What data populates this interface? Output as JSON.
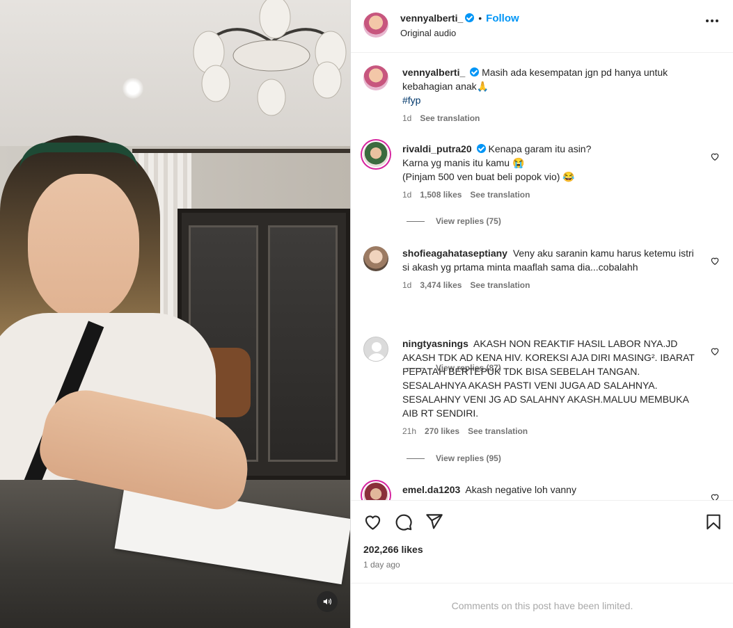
{
  "post": {
    "author": "vennyalberti_",
    "follow_label": "Follow",
    "dot": "•",
    "audio": "Original audio",
    "caption_username": "vennyalberti_",
    "caption_text": "Masih ada kesempatan jgn pd hanya untuk kebahagian anak🙏",
    "caption_hashtag": "#fyp",
    "caption_time": "1d",
    "caption_see_translation": "See translation",
    "likes": "202,266 likes",
    "time_ago": "1 day ago",
    "comments_limited": "Comments on this post have been limited."
  },
  "comments": [
    {
      "username": "rivaldi_putra20",
      "verified": true,
      "lines": [
        "Kenapa garam itu asin?",
        "Karna yg manis itu kamu 😭",
        "(Pinjam 500 ven buat beli popok vio) 😂"
      ],
      "time": "1d",
      "likes": "1,508 likes",
      "see_translation": "See translation",
      "replies": "View replies (75)"
    },
    {
      "username": "shofieagahataseptiany",
      "verified": false,
      "text": "Veny aku saranin kamu harus ketemu istri si akash yg prtama minta maaflah sama dia...cobalahh",
      "time": "1d",
      "likes": "3,474 likes",
      "see_translation": "See translation",
      "replies": "View replies (87)"
    },
    {
      "username": "ningtyasnings",
      "verified": false,
      "text": "AKASH NON REAKTIF HASIL LABOR NYA.JD AKASH TDK AD KENA HIV. KOREKSI AJA DIRI MASING². IBARAT PEPATAH BERTEPUK TDK BISA SEBELAH TANGAN. SESALAHNYA AKASH PASTI VENI JUGA AD SALAHNYA. SESALAHNY VENI JG AD SALAHNY AKASH.MALUU MEMBUKA AIB RT SENDIRI.",
      "time": "21h",
      "likes": "270 likes",
      "see_translation": "See translation",
      "replies": "View replies (95)"
    },
    {
      "username": "emel.da1203",
      "verified": false,
      "text": "Akash negative loh vanny"
    }
  ],
  "icons": {
    "more": "more-options-icon",
    "like": "heart-icon",
    "comment": "comment-icon",
    "share": "paper-plane-icon",
    "save": "bookmark-icon",
    "mute": "speaker-icon"
  },
  "colors": {
    "link": "#0095f6",
    "verified": "#0095f6",
    "muted": "#737373"
  }
}
